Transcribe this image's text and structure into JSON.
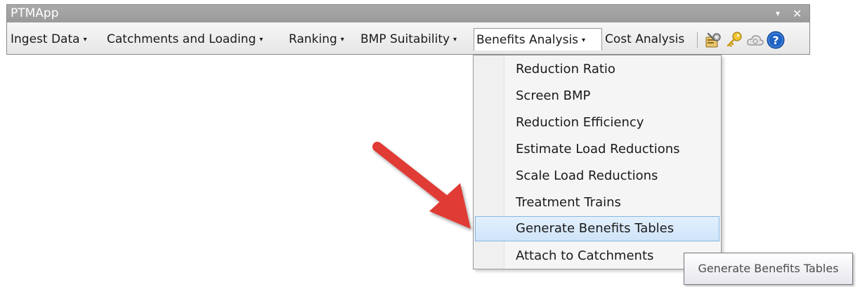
{
  "window": {
    "title": "PTMApp",
    "dropdown_control": "▾",
    "close_control": "✕"
  },
  "toolbar": {
    "menus": [
      {
        "label": "Ingest Data",
        "has_dropdown": true
      },
      {
        "label": "Catchments and Loading",
        "has_dropdown": true
      },
      {
        "label": "Ranking",
        "has_dropdown": true
      },
      {
        "label": "BMP Suitability",
        "has_dropdown": true
      },
      {
        "label": "Benefits Analysis",
        "has_dropdown": true,
        "open": true
      },
      {
        "label": "Cost Analysis",
        "has_dropdown": false
      }
    ],
    "caret": "▾",
    "icons": [
      "settings-tools-icon",
      "key-icon",
      "cloud-icon",
      "help-icon"
    ]
  },
  "dropdown": {
    "parent": "Benefits Analysis",
    "items": [
      {
        "label": "Reduction Ratio"
      },
      {
        "label": "Screen BMP"
      },
      {
        "label": "Reduction Efficiency"
      },
      {
        "label": "Estimate Load Reductions"
      },
      {
        "label": "Scale Load Reductions"
      },
      {
        "label": "Treatment Trains"
      },
      {
        "label": "Generate Benefits Tables",
        "highlighted": true
      },
      {
        "label": "Attach to Catchments"
      }
    ]
  },
  "tooltip": {
    "text": "Generate Benefits Tables"
  },
  "annotation": {
    "arrow_color": "#e03a35",
    "points_to": "Generate Benefits Tables"
  },
  "colors": {
    "titlebar": "#a3a3a3",
    "highlight_fill": "#d7e9fb",
    "highlight_border": "#88b7e3",
    "help_icon": "#1e63c4"
  }
}
